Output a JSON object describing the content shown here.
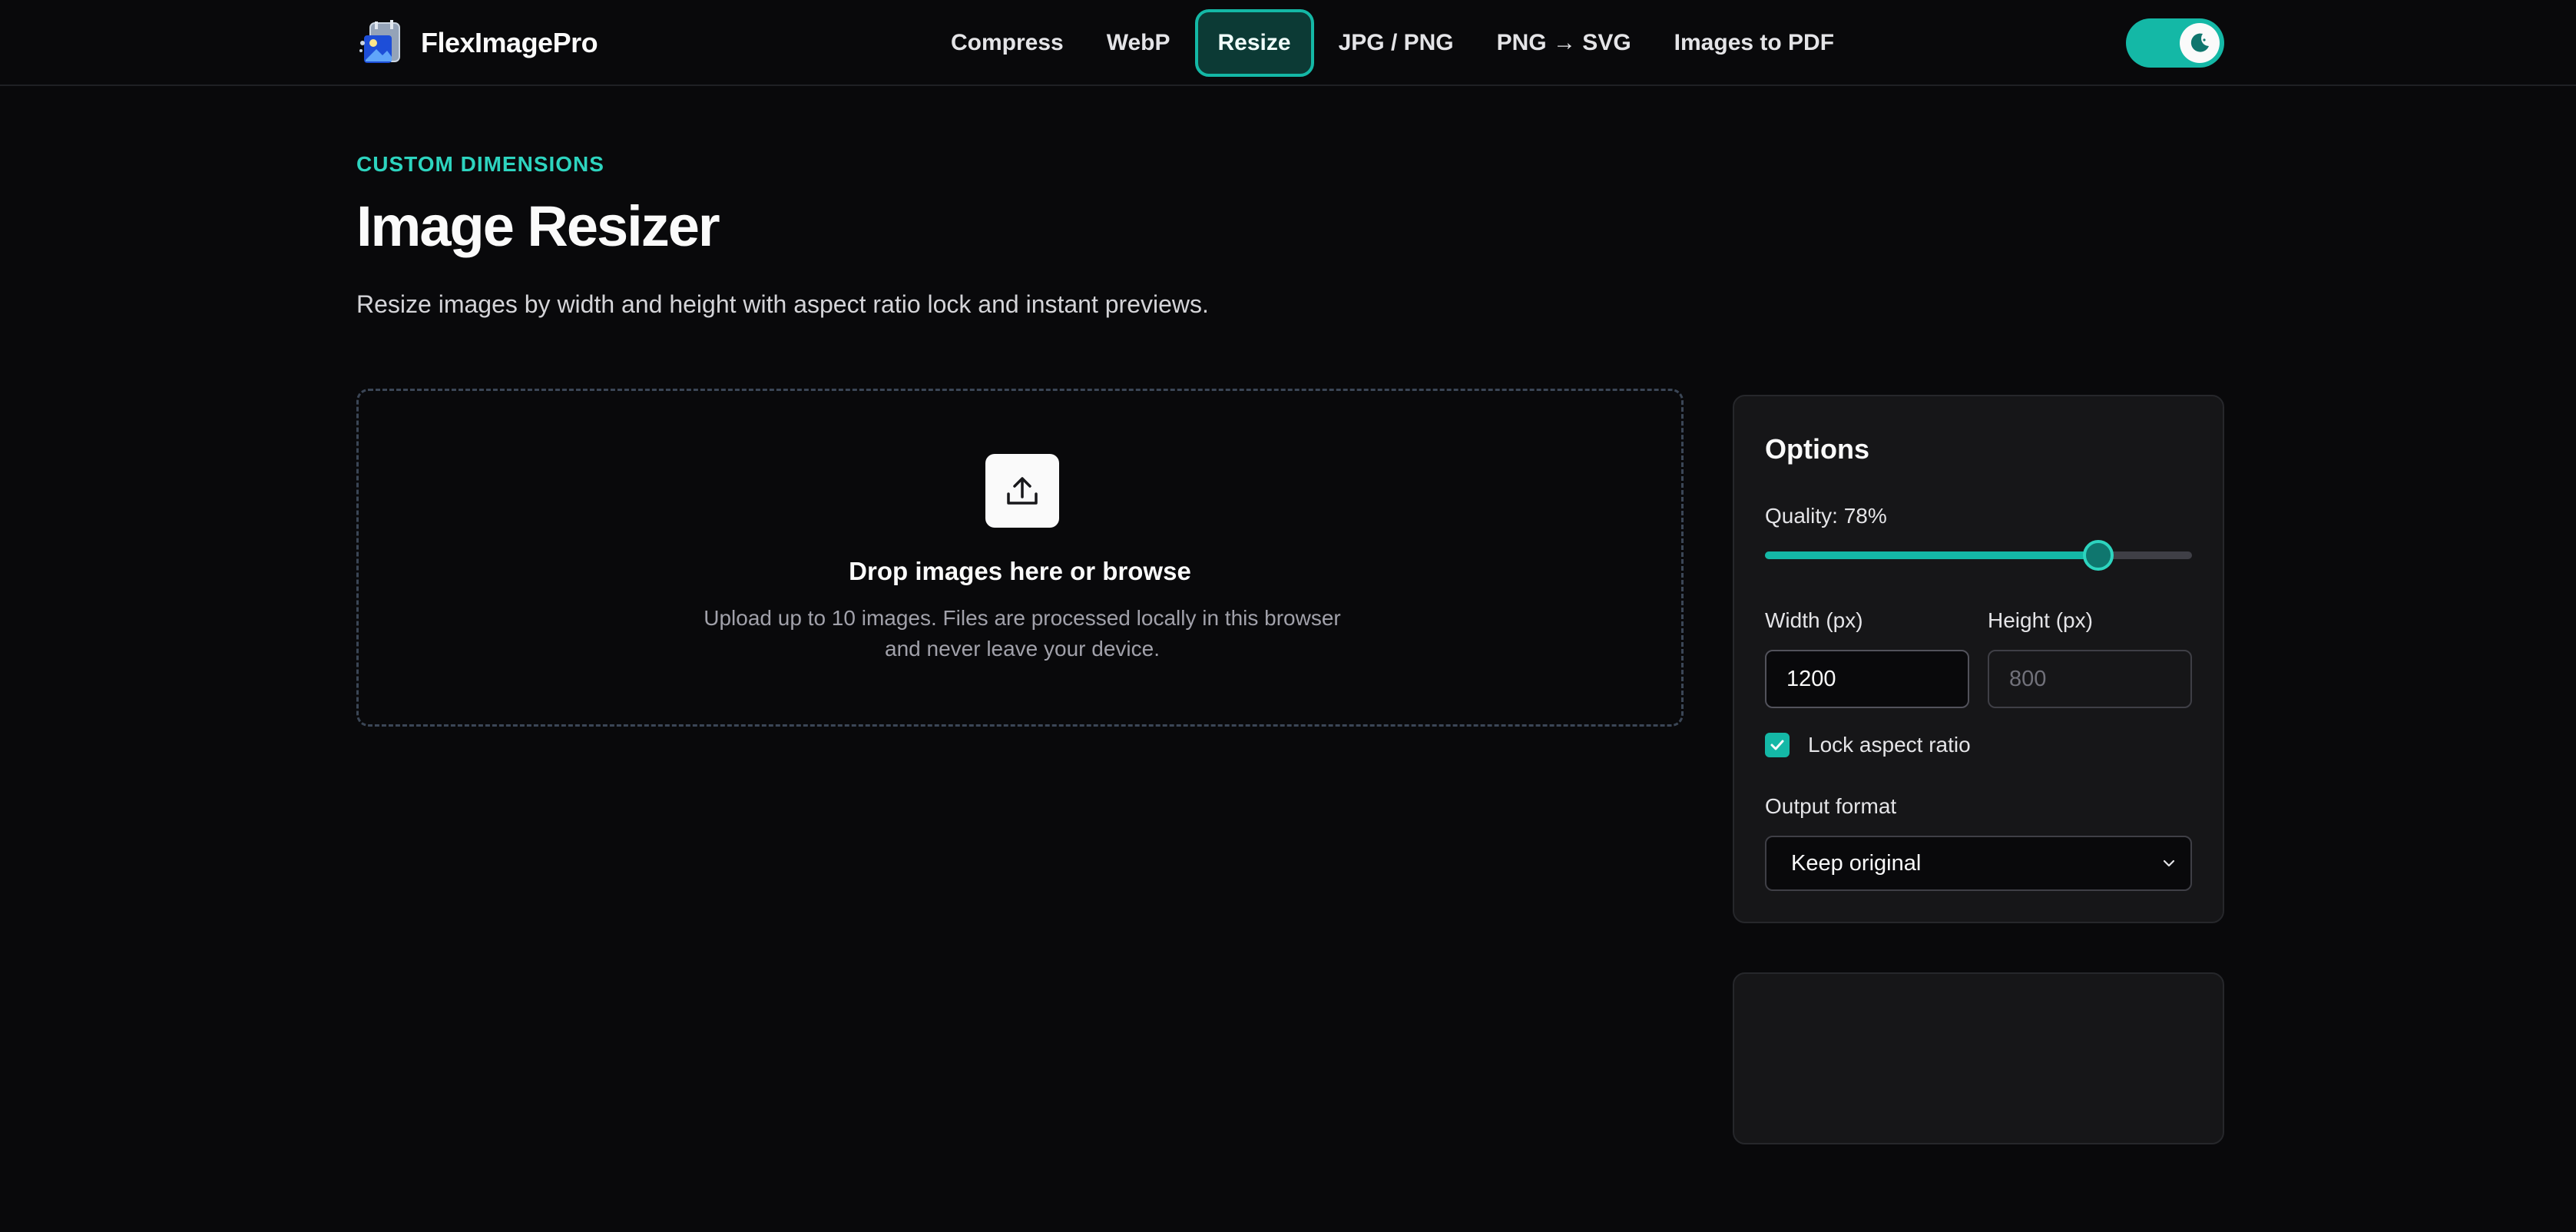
{
  "header": {
    "brand_name": "FlexImagePro",
    "nav": [
      {
        "label": "Compress"
      },
      {
        "label": "WebP"
      },
      {
        "label": "Resize",
        "active": true
      },
      {
        "label": "JPG / PNG"
      },
      {
        "label": "PNG → SVG"
      },
      {
        "label": "Images to PDF"
      }
    ],
    "theme_toggle": {
      "icon": "moon-icon",
      "enabled": true
    }
  },
  "hero": {
    "eyebrow": "CUSTOM DIMENSIONS",
    "title": "Image Resizer",
    "description": "Resize images by width and height with aspect ratio lock and instant previews."
  },
  "dropzone": {
    "icon": "upload-icon",
    "title": "Drop images here or browse",
    "subtitle": "Upload up to 10 images. Files are processed locally in this browser and never leave your device."
  },
  "options": {
    "title": "Options",
    "quality_label": "Quality: 78%",
    "quality_value": 78,
    "width_label": "Width (px)",
    "width_value": "1200",
    "height_label": "Height (px)",
    "height_placeholder": "800",
    "lock_aspect_label": "Lock aspect ratio",
    "lock_aspect_checked": true,
    "output_format_label": "Output format",
    "output_format_value": "Keep original"
  },
  "colors": {
    "accent": "#14b8a6",
    "accent_light": "#2dd4bf",
    "background": "#09090b",
    "panel": "#161618"
  }
}
